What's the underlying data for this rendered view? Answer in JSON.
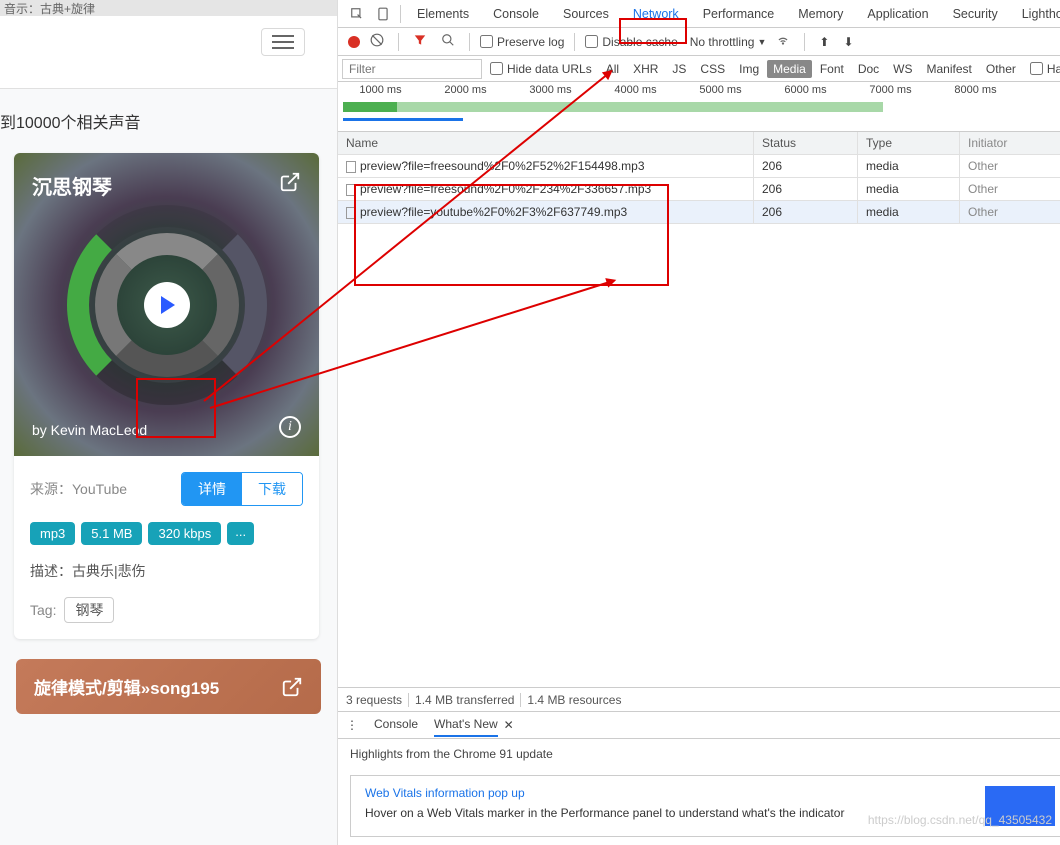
{
  "topbar_text": "音示：古典+旋律",
  "results_caption": "到10000个相关声音",
  "card1": {
    "title": "沉思钢琴",
    "artist": "by Kevin MacLeod",
    "source_label": "来源：",
    "source_value": "YouTube",
    "btn_detail": "详情",
    "btn_download": "下载",
    "badges": [
      "mp3",
      "5.1 MB",
      "320 kbps"
    ],
    "badge_more": "...",
    "desc_label": "描述：",
    "desc_value": "古典乐|悲伤",
    "tag_label": "Tag:",
    "tag_value": "钢琴"
  },
  "card2": {
    "title": "旋律模式/剪辑»song195"
  },
  "devtools": {
    "tabs": [
      "Elements",
      "Console",
      "Sources",
      "Network",
      "Performance",
      "Memory",
      "Application",
      "Security",
      "Lighthou"
    ],
    "active_tab": "Network",
    "toolbar": {
      "preserve_log": "Preserve log",
      "disable_cache": "Disable cache",
      "throttling": "No throttling"
    },
    "filter": {
      "placeholder": "Filter",
      "hide_data": "Hide data URLs",
      "types": [
        "All",
        "XHR",
        "JS",
        "CSS",
        "Img",
        "Media",
        "Font",
        "Doc",
        "WS",
        "Manifest",
        "Other"
      ],
      "selected": "Media",
      "has_blocked": "Has b"
    },
    "timeline_labels": [
      "1000 ms",
      "2000 ms",
      "3000 ms",
      "4000 ms",
      "5000 ms",
      "6000 ms",
      "7000 ms",
      "8000 ms"
    ],
    "columns": {
      "name": "Name",
      "status": "Status",
      "type": "Type",
      "initiator": "Initiator"
    },
    "rows": [
      {
        "name": "preview?file=freesound%2F0%2F52%2F154498.mp3",
        "status": "206",
        "type": "media",
        "initiator": "Other"
      },
      {
        "name": "preview?file=freesound%2F0%2F234%2F336657.mp3",
        "status": "206",
        "type": "media",
        "initiator": "Other"
      },
      {
        "name": "preview?file=youtube%2F0%2F3%2F637749.mp3",
        "status": "206",
        "type": "media",
        "initiator": "Other"
      }
    ],
    "footer": {
      "requests": "3 requests",
      "transferred": "1.4 MB transferred",
      "resources": "1.4 MB resources"
    },
    "drawer": {
      "tabs": [
        "Console",
        "What's New"
      ],
      "active": "What's New",
      "highlights": "Highlights from the Chrome 91 update",
      "vitals_title": "Web Vitals information pop up",
      "vitals_desc": "Hover on a Web Vitals marker in the Performance panel to understand what's the indicator"
    }
  },
  "watermark": "https://blog.csdn.net/qq_43505432"
}
